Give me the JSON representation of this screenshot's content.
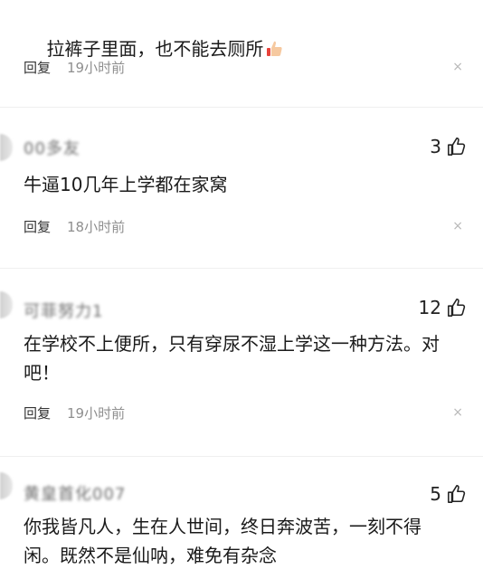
{
  "comments": [
    {
      "text": "拉裤子里面，也不能去厕所",
      "emoji": "thumbs-up-emoji",
      "reply": "回复",
      "time": "19小时前",
      "close": "×"
    },
    {
      "username": "00多友",
      "likes": "3",
      "text": "牛逼10几年上学都在家窝",
      "reply": "回复",
      "time": "18小时前",
      "close": "×"
    },
    {
      "username": "可菲努力1",
      "likes": "12",
      "text": "在学校不上便所，只有穿尿不湿上学这一种方法。对\n吧！",
      "reply": "回复",
      "time": "19小时前",
      "close": "×"
    },
    {
      "username": "黄皇首化007",
      "likes": "5",
      "text": "你我皆凡人，生在人世间，终日奔波苦，一刻不得\n闲。既然不是仙呐，难免有杂念"
    }
  ]
}
